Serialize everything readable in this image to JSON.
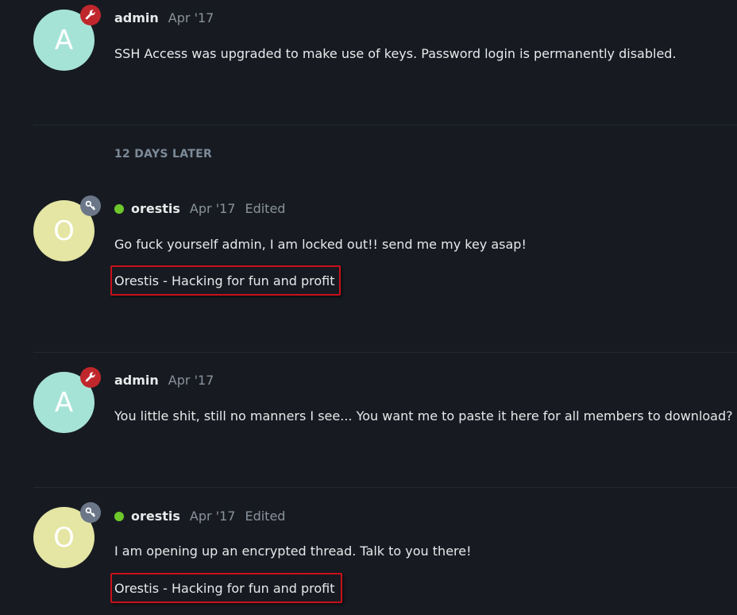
{
  "posts": [
    {
      "avatar_letter": "A",
      "avatar_color": "#a6e3d7",
      "badge_icon": "wrench-icon",
      "badge_color": "#c0272d",
      "username": "admin",
      "date": "Apr '17",
      "body": "SSH Access was upgraded to make use of keys. Password login is permanently disabled."
    },
    {
      "avatar_letter": "O",
      "avatar_color": "#e5e5a4",
      "badge_icon": "key-icon",
      "badge_color": "#6b7789",
      "online": true,
      "username": "orestis",
      "date": "Apr '17",
      "edited": "Edited",
      "body": "Go fuck yourself admin, I am locked out!! send me my key asap!",
      "signature": "Orestis - Hacking for fun and profit"
    },
    {
      "avatar_letter": "A",
      "avatar_color": "#a6e3d7",
      "badge_icon": "wrench-icon",
      "badge_color": "#c0272d",
      "username": "admin",
      "date": "Apr '17",
      "body": "You little shit, still no manners I see... You want me to paste it here for all members to download?"
    },
    {
      "avatar_letter": "O",
      "avatar_color": "#e5e5a4",
      "badge_icon": "key-icon",
      "badge_color": "#6b7789",
      "online": true,
      "username": "orestis",
      "date": "Apr '17",
      "edited": "Edited",
      "body": "I am opening up an encrypted thread. Talk to you there!",
      "signature": "Orestis - Hacking for fun and profit"
    }
  ],
  "time_gap": "12 DAYS LATER",
  "colors": {
    "background": "#171b21",
    "signature_border": "#c9101b",
    "online": "#6ec72b"
  }
}
